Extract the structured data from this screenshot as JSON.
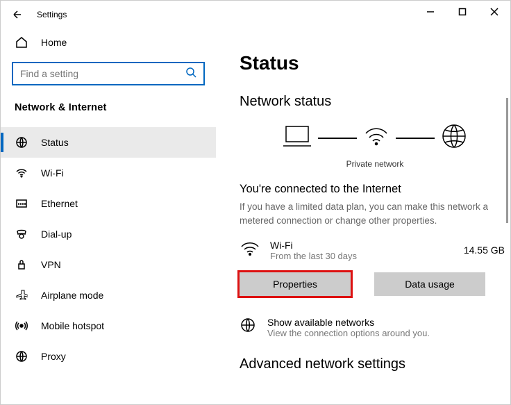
{
  "window": {
    "title": "Settings"
  },
  "sidebar": {
    "home": "Home",
    "search_placeholder": "Find a setting",
    "category": "Network & Internet",
    "items": [
      {
        "label": "Status"
      },
      {
        "label": "Wi-Fi"
      },
      {
        "label": "Ethernet"
      },
      {
        "label": "Dial-up"
      },
      {
        "label": "VPN"
      },
      {
        "label": "Airplane mode"
      },
      {
        "label": "Mobile hotspot"
      },
      {
        "label": "Proxy"
      }
    ]
  },
  "main": {
    "title": "Status",
    "section_title": "Network status",
    "diagram_caption": "Private network",
    "connected_heading": "You're connected to the Internet",
    "connected_desc": "If you have a limited data plan, you can make this network a metered connection or change other properties.",
    "connection": {
      "name": "Wi-Fi",
      "subtitle": "From the last 30 days",
      "data_used": "14.55 GB"
    },
    "buttons": {
      "properties": "Properties",
      "data_usage": "Data usage"
    },
    "available": {
      "title": "Show available networks",
      "subtitle": "View the connection options around you."
    },
    "advanced_title": "Advanced network settings"
  }
}
